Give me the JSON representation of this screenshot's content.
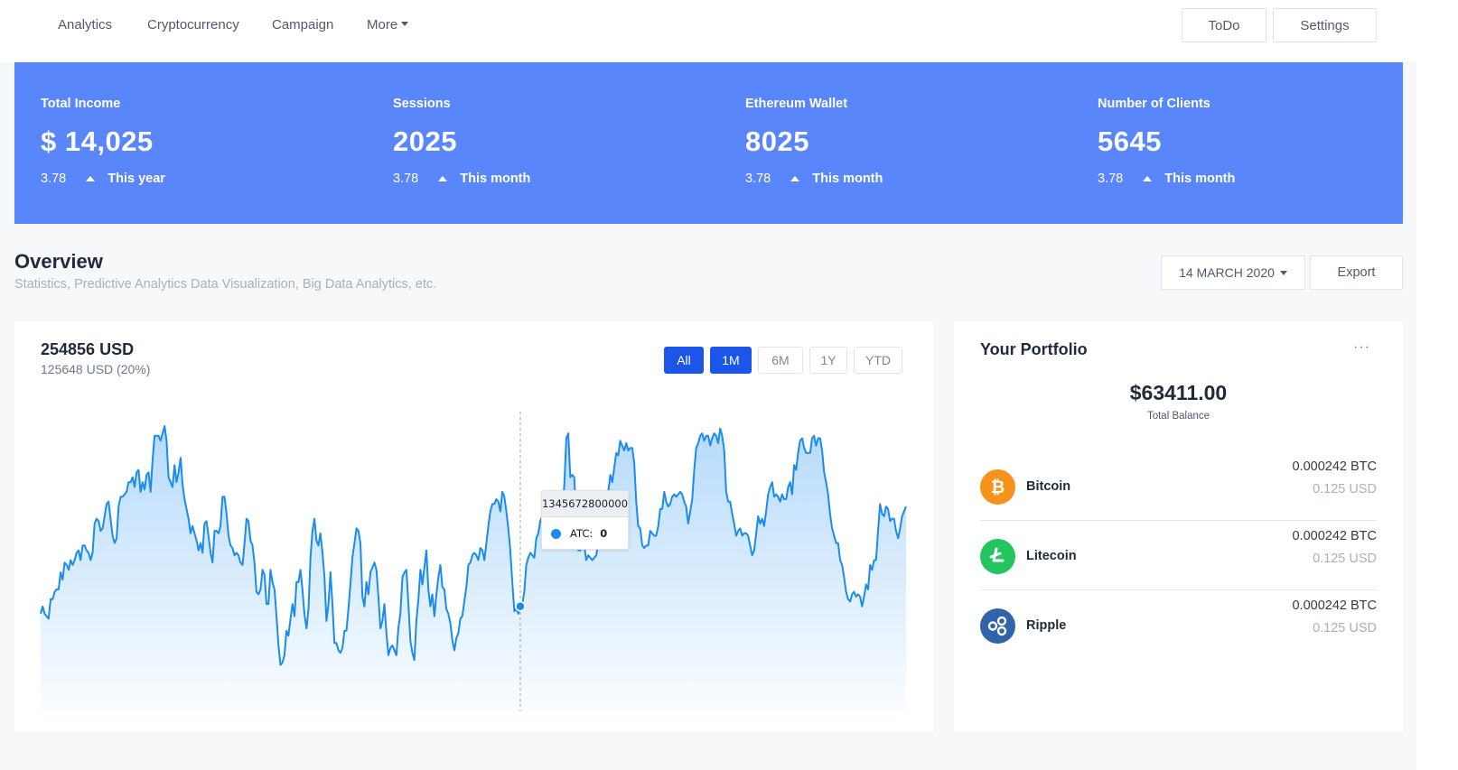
{
  "nav": {
    "links": [
      "Analytics",
      "Cryptocurrency",
      "Campaign",
      "More"
    ],
    "todo_label": "ToDo",
    "settings_label": "Settings"
  },
  "stats": [
    {
      "label": "Total Income",
      "value": "$ 14,025",
      "change": "3.78",
      "period": "This year"
    },
    {
      "label": "Sessions",
      "value": "2025",
      "change": "3.78",
      "period": "This month"
    },
    {
      "label": "Ethereum Wallet",
      "value": "8025",
      "change": "3.78",
      "period": "This month"
    },
    {
      "label": "Number of Clients",
      "value": "5645",
      "change": "3.78",
      "period": "This month"
    }
  ],
  "overview": {
    "title": "Overview",
    "subtitle": "Statistics, Predictive Analytics Data Visualization, Big Data Analytics, etc.",
    "date_label": "14 MARCH 2020",
    "export_label": "Export"
  },
  "chart_card": {
    "amount": "254856 USD",
    "sub": "125648 USD (20%)",
    "ranges": [
      "All",
      "1M",
      "6M",
      "1Y",
      "YTD"
    ],
    "active_ranges": [
      "All",
      "1M"
    ],
    "tooltip": {
      "title": "1345672800000",
      "series": "ATC:",
      "value": "0"
    }
  },
  "chart_data": {
    "type": "area",
    "title": "",
    "xlabel": "",
    "ylabel": "",
    "grid": false,
    "series": [
      {
        "color": "#1a8cf0",
        "values": [
          23,
          26,
          23,
          22,
          21,
          29,
          29,
          32,
          33,
          33,
          40,
          37,
          44,
          43,
          41,
          45,
          43,
          45,
          48,
          49,
          45,
          51,
          51,
          49,
          48,
          45,
          48,
          60,
          62,
          61,
          57,
          58,
          63,
          68,
          69,
          62,
          55,
          52,
          54,
          67,
          71,
          71,
          72,
          73,
          77,
          77,
          79,
          75,
          81,
          82,
          73,
          77,
          74,
          80,
          81,
          73,
          86,
          96,
          96,
          96,
          94,
          97,
          100,
          94,
          79,
          77,
          75,
          84,
          77,
          81,
          87,
          76,
          70,
          66,
          62,
          56,
          59,
          56,
          53,
          49,
          52,
          48,
          60,
          61,
          55,
          48,
          44,
          57,
          57,
          56,
          59,
          71,
          71,
          64,
          55,
          51,
          50,
          47,
          48,
          47,
          44,
          43,
          52,
          62,
          61,
          53,
          51,
          44,
          32,
          31,
          33,
          41,
          39,
          27,
          27,
          41,
          36,
          33,
          22,
          10,
          2,
          3,
          6,
          16,
          14,
          21,
          27,
          22,
          36,
          36,
          41,
          33,
          23,
          17,
          25,
          46,
          57,
          62,
          53,
          51,
          56,
          48,
          38,
          20,
          27,
          40,
          27,
          11,
          11,
          8,
          7,
          9,
          16,
          16,
          25,
          35,
          46,
          52,
          58,
          57,
          52,
          30,
          26,
          36,
          31,
          40,
          42,
          44,
          41,
          30,
          17,
          20,
          27,
          15,
          6,
          9,
          10,
          8,
          6,
          17,
          23,
          38,
          40,
          41,
          27,
          12,
          7,
          4,
          20,
          29,
          41,
          35,
          42,
          49,
          33,
          26,
          31,
          22,
          31,
          38,
          43,
          34,
          33,
          25,
          23,
          19,
          12,
          8,
          13,
          15,
          21,
          22,
          28,
          34,
          43,
          44,
          47,
          48,
          47,
          45,
          50,
          49,
          45,
          52,
          59,
          65,
          68,
          68,
          70,
          69,
          65,
          73,
          71,
          65,
          58,
          49,
          36,
          24,
          25,
          23,
          26,
          27,
          32,
          43,
          46,
          48,
          47,
          46,
          54,
          56,
          61,
          63,
          66,
          67,
          65,
          64,
          65,
          65,
          63,
          59,
          60,
          65,
          76,
          95,
          97,
          79,
          80,
          79,
          62,
          49,
          49,
          52,
          51,
          45,
          47,
          46,
          45,
          46,
          47,
          52,
          60,
          63,
          64,
          72,
          73,
          80,
          77,
          83,
          89,
          88,
          94,
          92,
          90,
          93,
          90,
          91,
          91,
          85,
          69,
          59,
          58,
          51,
          50,
          51,
          51,
          57,
          56,
          55,
          55,
          59,
          66,
          66,
          73,
          69,
          67,
          68,
          71,
          72,
          71,
          72,
          73,
          72,
          69,
          67,
          60,
          65,
          70,
          82,
          91,
          93,
          96,
          97,
          94,
          96,
          96,
          92,
          95,
          97,
          96,
          93,
          99,
          96,
          90,
          73,
          69,
          69,
          64,
          60,
          55,
          57,
          58,
          55,
          56,
          56,
          55,
          51,
          47,
          49,
          56,
          63,
          60,
          62,
          59,
          65,
          72,
          75,
          77,
          71,
          72,
          71,
          69,
          72,
          70,
          70,
          75,
          77,
          72,
          84,
          82,
          89,
          94,
          95,
          91,
          89,
          89,
          89,
          95,
          96,
          92,
          95,
          95,
          90,
          81,
          77,
          72,
          64,
          58,
          55,
          52,
          52,
          45,
          43,
          38,
          32,
          29,
          28,
          31,
          32,
          30,
          31,
          30,
          26,
          30,
          35,
          33,
          43,
          41,
          45,
          45,
          57,
          68,
          64,
          63,
          67,
          66,
          61,
          62,
          62,
          57,
          54,
          58,
          63,
          65,
          67
        ]
      }
    ],
    "ylim": [
      0,
      100
    ],
    "tooltip_index": 240
  },
  "portfolio": {
    "title": "Your Portfolio",
    "menu": "···",
    "balance": "$63411.00",
    "balance_label": "Total Balance",
    "coins": [
      {
        "name": "Bitcoin",
        "btc": "0.000242 BTC",
        "usd": "0.125 USD",
        "color": "#f7931a",
        "icon": "bitcoin-icon"
      },
      {
        "name": "Litecoin",
        "btc": "0.000242 BTC",
        "usd": "0.125 USD",
        "color": "#22c55e",
        "icon": "litecoin-icon"
      },
      {
        "name": "Ripple",
        "btc": "0.000242 BTC",
        "usd": "0.125 USD",
        "color": "#2f64a8",
        "icon": "ripple-icon"
      }
    ]
  }
}
